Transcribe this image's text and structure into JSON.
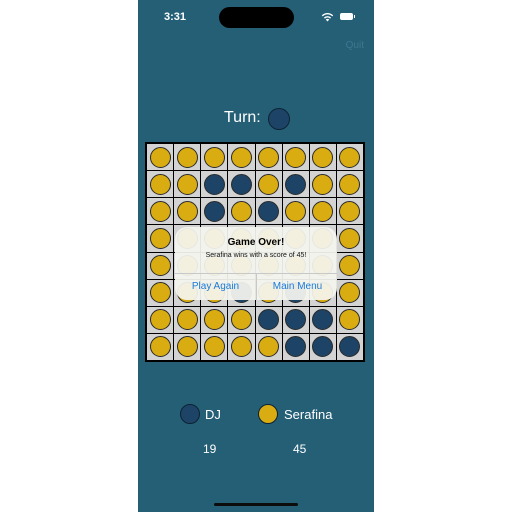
{
  "status": {
    "time": "3:31"
  },
  "header": {
    "quit_label": "Quit"
  },
  "turn": {
    "label": "Turn:",
    "disc_color": "#1d4466"
  },
  "colors": {
    "yellow": "#d9ac12",
    "blue": "#1d4466",
    "background": "#245f76"
  },
  "board": {
    "rows": [
      [
        "Y",
        "Y",
        "Y",
        "Y",
        "Y",
        "Y",
        "Y",
        "Y"
      ],
      [
        "Y",
        "Y",
        "B",
        "B",
        "Y",
        "B",
        "Y",
        "Y"
      ],
      [
        "Y",
        "Y",
        "B",
        "Y",
        "B",
        "Y",
        "Y",
        "Y"
      ],
      [
        "Y",
        "Y",
        "Y",
        "Y",
        "Y",
        "Y",
        "Y",
        "Y"
      ],
      [
        "Y",
        "Y",
        "Y",
        "Y",
        "Y",
        "Y",
        "Y",
        "Y"
      ],
      [
        "Y",
        "Y",
        "Y",
        "B",
        "Y",
        "B",
        "Y",
        "Y"
      ],
      [
        "Y",
        "Y",
        "Y",
        "Y",
        "B",
        "B",
        "B",
        "Y"
      ],
      [
        "Y",
        "Y",
        "Y",
        "Y",
        "Y",
        "B",
        "B",
        "B"
      ]
    ]
  },
  "alert": {
    "title": "Game Over!",
    "message": "Serafina wins with a score of 45!",
    "play_again_label": "Play Again",
    "main_menu_label": "Main Menu"
  },
  "players": [
    {
      "name": "DJ",
      "color": "#1d4466",
      "score": "19"
    },
    {
      "name": "Serafina",
      "color": "#d9ac12",
      "score": "45"
    }
  ]
}
